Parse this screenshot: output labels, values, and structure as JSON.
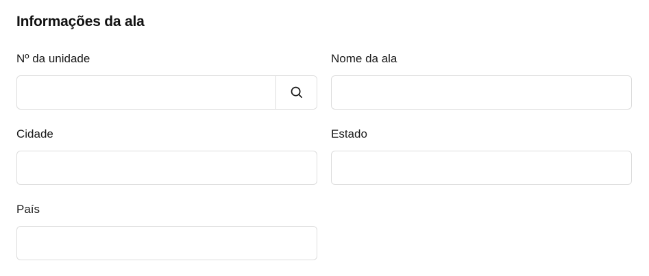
{
  "section": {
    "title": "Informações da ala"
  },
  "fields": {
    "unit_number": {
      "label": "Nº da unidade",
      "value": "",
      "placeholder": ""
    },
    "ward_name": {
      "label": "Nome da ala",
      "value": "",
      "placeholder": ""
    },
    "city": {
      "label": "Cidade",
      "value": "",
      "placeholder": ""
    },
    "state": {
      "label": "Estado",
      "value": "",
      "placeholder": ""
    },
    "country": {
      "label": "País",
      "value": "",
      "placeholder": ""
    }
  },
  "icons": {
    "search": "search-icon"
  }
}
